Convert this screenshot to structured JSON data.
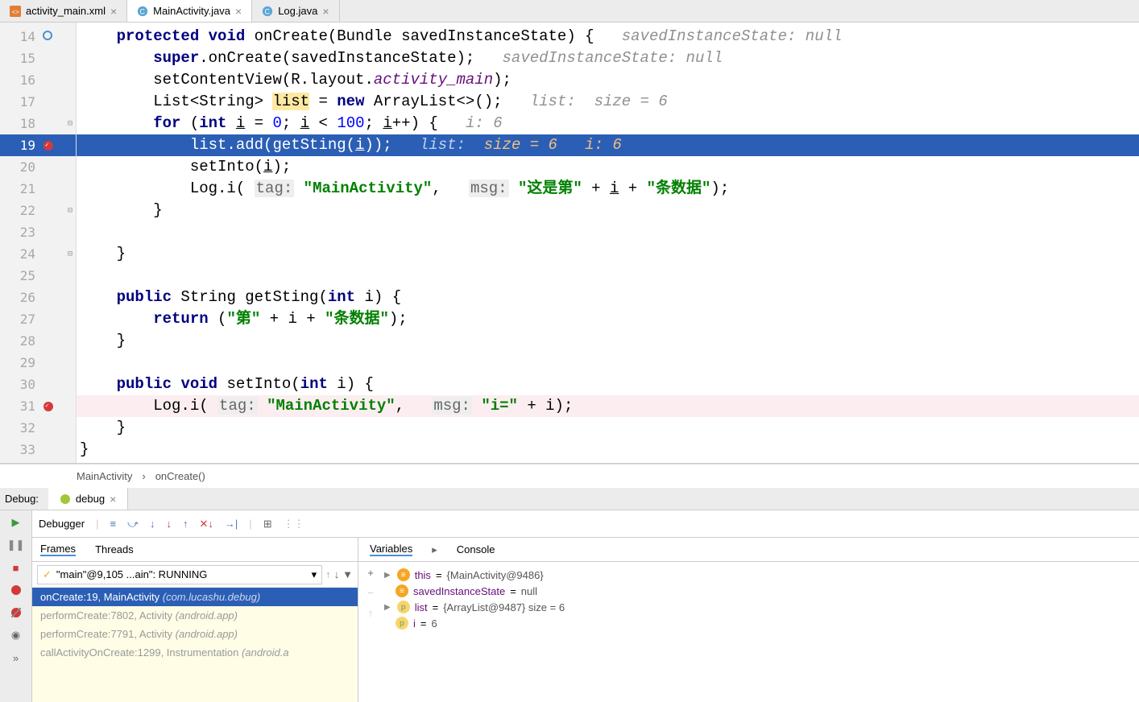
{
  "tabs": [
    {
      "label": "activity_main.xml"
    },
    {
      "label": "MainActivity.java"
    },
    {
      "label": "Log.java"
    }
  ],
  "breadcrumb": {
    "a": "MainActivity",
    "b": "onCreate()"
  },
  "code": {
    "l14": {
      "num": "14",
      "kw1": "protected",
      "kw2": "void",
      "m": "onCreate",
      "arg": "(Bundle savedInstanceState) {",
      "hint": "savedInstanceState: null"
    },
    "l15": {
      "num": "15",
      "kw": "super",
      "t": ".onCreate(savedInstanceState);",
      "hint": "savedInstanceState: null"
    },
    "l16": {
      "num": "16",
      "t1": "setContentView(R.layout.",
      "purple": "activity_main",
      "t2": ");"
    },
    "l17": {
      "num": "17",
      "t1": "List<String>",
      "hl": "list",
      "t2": " = ",
      "kw": "new",
      "t3": " ArrayList<>();",
      "hint": "list:  size = 6"
    },
    "l18": {
      "num": "18",
      "kw": "for",
      "t1": " (",
      "kw2": "int",
      "t2": " ",
      "u": "i",
      "t3": " = ",
      "n1": "0",
      "t4": "; ",
      "u2": "i",
      "t5": " < ",
      "n2": "100",
      "t6": "; ",
      "u3": "i",
      "t7": "++) {",
      "hint": "i: 6"
    },
    "l19": {
      "num": "19",
      "t": "list.add(getSting(",
      "u": "i",
      "t2": "));",
      "h1": "list:",
      "h2": "size = 6",
      "h3": "i: 6"
    },
    "l20": {
      "num": "20",
      "t": "setInto(",
      "u": "i",
      "t2": ");"
    },
    "l21": {
      "num": "21",
      "t1": "Log.i(",
      "tag": "tag:",
      "s1": "\"MainActivity\"",
      "t2": ",",
      "msg": "msg:",
      "s2": "\"这是第\"",
      "t3": " + ",
      "u": "i",
      "t4": " + ",
      "s3": "\"条数据\"",
      "t5": ");"
    },
    "l22": {
      "num": "22",
      "t": "}"
    },
    "l23": {
      "num": "23"
    },
    "l24": {
      "num": "24",
      "t": "}"
    },
    "l25": {
      "num": "25"
    },
    "l26": {
      "num": "26",
      "kw": "public",
      "t1": " String getSting(",
      "kw2": "int",
      "t2": " i) {"
    },
    "l27": {
      "num": "27",
      "kw": "return",
      "t1": " (",
      "s1": "\"第\"",
      "t2": " + i + ",
      "s2": "\"条数据\"",
      "t3": ");"
    },
    "l28": {
      "num": "28",
      "t": "}"
    },
    "l29": {
      "num": "29"
    },
    "l30": {
      "num": "30",
      "kw": "public",
      "kw2": "void",
      "t1": " setInto(",
      "kw3": "int",
      "t2": " i) {"
    },
    "l31": {
      "num": "31",
      "t1": "Log.i(",
      "tag": "tag:",
      "s1": "\"MainActivity\"",
      "t2": ",",
      "msg": "msg:",
      "s2": "\"i=\"",
      "t3": " + i);"
    },
    "l32": {
      "num": "32",
      "t": "}"
    },
    "l33": {
      "num": "33",
      "t": "}"
    }
  },
  "debug": {
    "label": "Debug:",
    "tabName": "debug",
    "debuggerTab": "Debugger",
    "framesTab": "Frames",
    "threadsTab": "Threads",
    "variablesTab": "Variables",
    "consoleTab": "Console",
    "threadSelect": "\"main\"@9,105 ...ain\": RUNNING",
    "frames": [
      {
        "main": "onCreate:19, MainActivity",
        "dim": "(com.lucashu.debug)",
        "sel": true
      },
      {
        "main": "performCreate:7802, Activity",
        "dim": "(android.app)"
      },
      {
        "main": "performCreate:7791, Activity",
        "dim": "(android.app)"
      },
      {
        "main": "callActivityOnCreate:1299, Instrumentation",
        "dim": "(android.a"
      }
    ],
    "vars": [
      {
        "icon": "orange",
        "glyph": "≡",
        "name": "this",
        "eq": " = ",
        "val": "{MainActivity@9486}",
        "expand": true
      },
      {
        "icon": "orange",
        "glyph": "≡",
        "name": "savedInstanceState",
        "eq": " = ",
        "val": "null"
      },
      {
        "icon": "yellow",
        "glyph": "p",
        "name": "list",
        "eq": " = ",
        "val": "{ArrayList@9487}  size = 6",
        "expand": true
      },
      {
        "icon": "yellow",
        "glyph": "p",
        "name": "i",
        "eq": " = ",
        "val": "6"
      }
    ]
  }
}
